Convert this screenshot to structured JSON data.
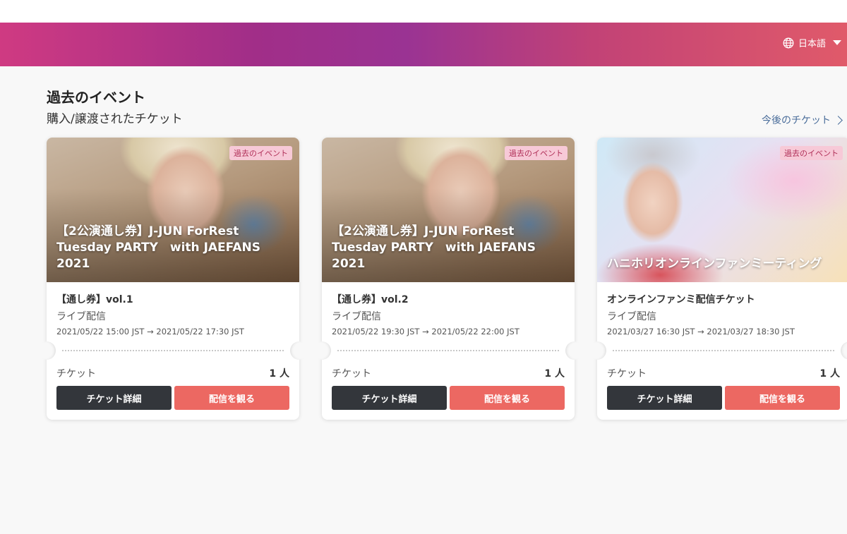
{
  "header": {
    "language": "日本語",
    "language_icon": "globe-icon"
  },
  "page": {
    "title": "過去のイベント",
    "subtitle": "購入/譲渡されたチケット",
    "next_link": "今後のチケット"
  },
  "events": [
    {
      "badge": "過去のイベント",
      "title": "【2公演通し券】J-JUN ForRest\nTuesday PARTY　with JAEFANS\n2021",
      "ticket_name": "【通し券】vol.1",
      "type": "ライブ配信",
      "date": "2021/05/22 15:00 JST → 2021/05/22 17:30 JST",
      "qty_label": "チケット",
      "qty_value": "1 人",
      "detail_button": "チケット詳細",
      "watch_button": "配信を観る"
    },
    {
      "badge": "過去のイベント",
      "title": "【2公演通し券】J-JUN ForRest\nTuesday PARTY　with JAEFANS\n2021",
      "ticket_name": "【通し券】vol.2",
      "type": "ライブ配信",
      "date": "2021/05/22 19:30 JST → 2021/05/22 22:00 JST",
      "qty_label": "チケット",
      "qty_value": "1 人",
      "detail_button": "チケット詳細",
      "watch_button": "配信を観る"
    },
    {
      "badge": "過去のイベント",
      "title": "ハニホリオンラインファンミーティング",
      "ticket_name": "オンラインファンミ配信チケット",
      "type": "ライブ配信",
      "date": "2021/03/27 16:30 JST → 2021/03/27 18:30 JST",
      "qty_label": "チケット",
      "qty_value": "1 人",
      "detail_button": "チケット詳細",
      "watch_button": "配信を観る"
    }
  ],
  "colors": {
    "banner_gradient": [
      "#cf3a82",
      "#9a3393",
      "#e05a6a"
    ],
    "watch_button": "#ec6862",
    "detail_button": "#33363b",
    "badge_bg": "#f7c9d7",
    "link": "#4a6d9a"
  }
}
